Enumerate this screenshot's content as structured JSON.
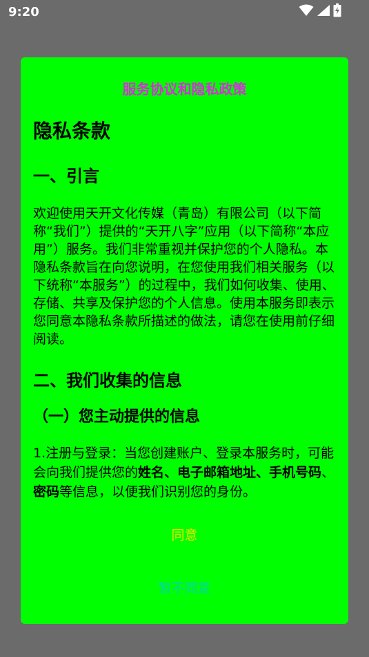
{
  "status_bar": {
    "time": "9:20",
    "icons": [
      "wifi-icon",
      "signal-icon",
      "battery-icon"
    ]
  },
  "dialog": {
    "title": "服务协议和隐私政策",
    "content": {
      "heading1": "隐私条款",
      "section1_title": "一、引言",
      "section1_body": "欢迎使用天开文化传媒（青岛）有限公司（以下简称“我们”）提供的“天开八字”应用（以下简称“本应用”）服务。我们非常重视并保护您的个人隐私。本隐私条款旨在向您说明，在您使用我们相关服务（以下统称“本服务”）的过程中，我们如何收集、使用、存储、共享及保护您的个人信息。使用本服务即表示您同意本隐私条款所描述的做法，请您在使用前仔细阅读。",
      "section2_title": "二、我们收集的信息",
      "subsection1_title": "（一）您主动提供的信息",
      "item1_prefix": "1.注册与登录：当您创建账户、登录本服务时，可能会向我们提供您的",
      "item1_bold1": "姓名、电子邮箱地址、手机号码",
      "item1_sep": "、",
      "item1_bold2": "密码",
      "item1_suffix": "等信息，以便我们识别您的身份。"
    },
    "agree_label": "同意",
    "disagree_label": "暂不同意"
  },
  "colors": {
    "overlay": "#6b6b6b",
    "dialog_bg": "#00ff00",
    "title": "#d630d8",
    "agree": "#e8e800",
    "disagree": "#00d9a0"
  }
}
